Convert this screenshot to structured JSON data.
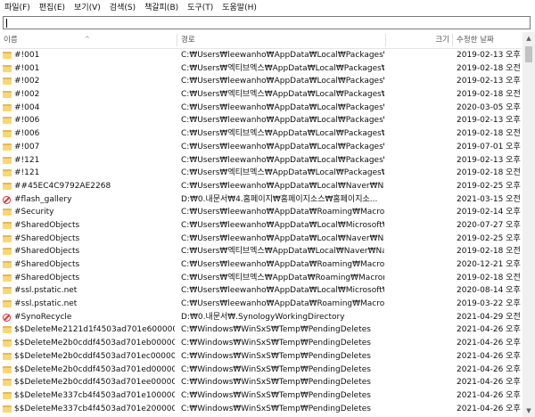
{
  "menu": [
    "파일(F)",
    "편집(E)",
    "보기(V)",
    "검색(S)",
    "책갈피(B)",
    "도구(T)",
    "도움말(H)"
  ],
  "search": {
    "value": ""
  },
  "columns": {
    "name": "이름",
    "path": "경로",
    "size": "크기",
    "modified": "수정한 날짜"
  },
  "rows": [
    {
      "icon": "folder",
      "name": "#!001",
      "path": "C:₩Users₩leewanho₩AppData₩Local₩Packages₩Mic...",
      "modified": "2019-02-13 오후"
    },
    {
      "icon": "folder",
      "name": "#!001",
      "path": "C:₩Users₩엑티브엑스₩AppData₩Local₩Packages₩Mi...",
      "modified": "2019-02-18 오전"
    },
    {
      "icon": "folder",
      "name": "#!002",
      "path": "C:₩Users₩leewanho₩AppData₩Local₩Packages₩Mic...",
      "modified": "2019-02-13 오후"
    },
    {
      "icon": "folder",
      "name": "#!002",
      "path": "C:₩Users₩엑티브엑스₩AppData₩Local₩Packages₩Mi...",
      "modified": "2019-02-18 오전"
    },
    {
      "icon": "folder",
      "name": "#!004",
      "path": "C:₩Users₩leewanho₩AppData₩Local₩Packages₩Mic...",
      "modified": "2020-03-05 오후"
    },
    {
      "icon": "folder",
      "name": "#!006",
      "path": "C:₩Users₩leewanho₩AppData₩Local₩Packages₩Mic...",
      "modified": "2019-02-13 오후"
    },
    {
      "icon": "folder",
      "name": "#!006",
      "path": "C:₩Users₩엑티브엑스₩AppData₩Local₩Packages₩Mi...",
      "modified": "2019-02-18 오전"
    },
    {
      "icon": "folder",
      "name": "#!007",
      "path": "C:₩Users₩leewanho₩AppData₩Local₩Packages₩Mic...",
      "modified": "2019-07-01 오후"
    },
    {
      "icon": "folder",
      "name": "#!121",
      "path": "C:₩Users₩leewanho₩AppData₩Local₩Packages₩Mic...",
      "modified": "2019-02-13 오후"
    },
    {
      "icon": "folder",
      "name": "#!121",
      "path": "C:₩Users₩엑티브엑스₩AppData₩Local₩Packages₩Mi...",
      "modified": "2019-02-18 오전"
    },
    {
      "icon": "folder",
      "name": "##45EC4C9792AE2268",
      "path": "C:₩Users₩leewanho₩AppData₩Local₩Naver₩Naver ...",
      "modified": "2019-02-25 오후"
    },
    {
      "icon": "forbid",
      "name": "#flash_gallery",
      "path": "D:₩0.내문서₩4.홈페이지₩홈페이지소스₩홈페이지소...",
      "modified": "2021-03-15 오전"
    },
    {
      "icon": "folder",
      "name": "#Security",
      "path": "C:₩Users₩leewanho₩AppData₩Roaming₩Macromed...",
      "modified": "2019-02-14 오후"
    },
    {
      "icon": "folder",
      "name": "#SharedObjects",
      "path": "C:₩Users₩leewanho₩AppData₩Local₩Microsoft₩Ed...",
      "modified": "2020-07-27 오후"
    },
    {
      "icon": "folder",
      "name": "#SharedObjects",
      "path": "C:₩Users₩leewanho₩AppData₩Local₩Naver₩Naver ...",
      "modified": "2019-02-25 오후"
    },
    {
      "icon": "folder",
      "name": "#SharedObjects",
      "path": "C:₩Users₩엑티브엑스₩AppData₩Local₩Naver₩Naver ...",
      "modified": "2019-02-18 오전"
    },
    {
      "icon": "folder",
      "name": "#SharedObjects",
      "path": "C:₩Users₩leewanho₩AppData₩Roaming₩Macromed...",
      "modified": "2020-12-21 오후"
    },
    {
      "icon": "folder",
      "name": "#SharedObjects",
      "path": "C:₩Users₩엑티브엑스₩AppData₩Roaming₩Macrome...",
      "modified": "2019-02-18 오전"
    },
    {
      "icon": "folder",
      "name": "#ssl.pstatic.net",
      "path": "C:₩Users₩leewanho₩AppData₩Local₩Microsoft₩Ed...",
      "modified": "2020-08-14 오후"
    },
    {
      "icon": "folder",
      "name": "#ssl.pstatic.net",
      "path": "C:₩Users₩leewanho₩AppData₩Roaming₩Macromed...",
      "modified": "2019-03-22 오후"
    },
    {
      "icon": "forbid",
      "name": "#SynoRecycle",
      "path": "D:₩0.내문서₩.SynologyWorkingDirectory",
      "modified": "2021-04-29 오전"
    },
    {
      "icon": "folder",
      "name": "$$DeleteMe2121d1f4503ad701e600000...",
      "path": "C:₩Windows₩WinSxS₩Temp₩PendingDeletes",
      "modified": "2021-04-26 오후"
    },
    {
      "icon": "folder",
      "name": "$$DeleteMe2b0cddf4503ad701eb00000...",
      "path": "C:₩Windows₩WinSxS₩Temp₩PendingDeletes",
      "modified": "2021-04-26 오후"
    },
    {
      "icon": "folder",
      "name": "$$DeleteMe2b0cddf4503ad701ec00000...",
      "path": "C:₩Windows₩WinSxS₩Temp₩PendingDeletes",
      "modified": "2021-04-26 오후"
    },
    {
      "icon": "folder",
      "name": "$$DeleteMe2b0cddf4503ad701ed00000...",
      "path": "C:₩Windows₩WinSxS₩Temp₩PendingDeletes",
      "modified": "2021-04-26 오후"
    },
    {
      "icon": "folder",
      "name": "$$DeleteMe2b0cddf4503ad701ee00000...",
      "path": "C:₩Windows₩WinSxS₩Temp₩PendingDeletes",
      "modified": "2021-04-26 오후"
    },
    {
      "icon": "folder",
      "name": "$$DeleteMe337cb4f4503ad701e100000...",
      "path": "C:₩Windows₩WinSxS₩Temp₩PendingDeletes",
      "modified": "2021-04-26 오후"
    },
    {
      "icon": "folder",
      "name": "$$DeleteMe337cb4f4503ad701e200000...",
      "path": "C:₩Windows₩WinSxS₩Temp₩PendingDeletes",
      "modified": "2021-04-26 오후"
    }
  ],
  "colors": {
    "folder": "#f8d775",
    "forbid": "#dd3333"
  }
}
